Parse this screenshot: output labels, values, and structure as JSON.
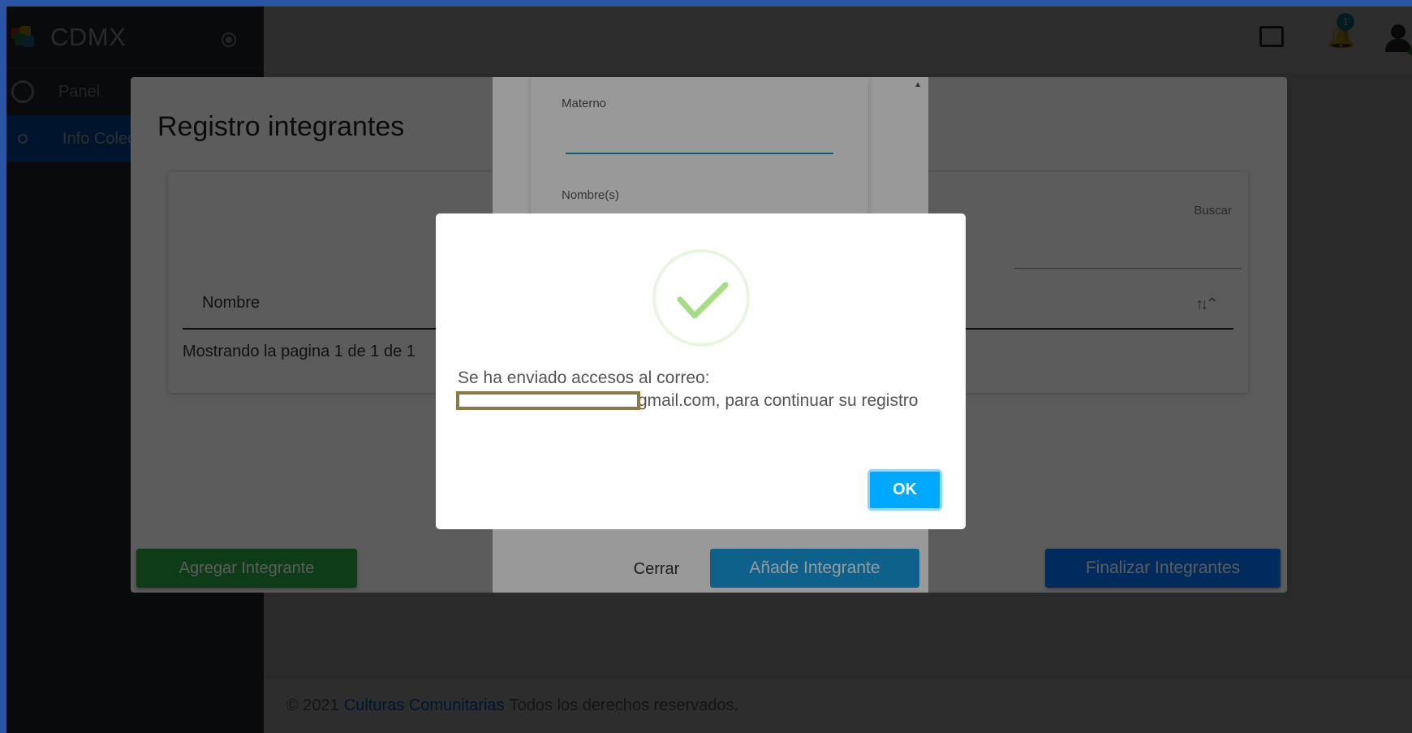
{
  "sidebar": {
    "brand": "CDMX",
    "items": [
      {
        "label": "Panel"
      },
      {
        "label": "Info Colectivo"
      }
    ]
  },
  "topbar": {
    "notification_count": "1"
  },
  "footer": {
    "copyright": "© 2021",
    "link": "Culturas Comunitarias",
    "rights": "Todos los derechos reservados."
  },
  "registro_modal": {
    "title": "Registro integrantes",
    "search_label": "Buscar",
    "column_header": "Nombre",
    "pagination_text": "Mostrando la pagina 1 de 1 de 1",
    "add_button": "Agregar Integrante",
    "finish_button": "Finalizar Integrantes"
  },
  "add_modal": {
    "materno_label": "Materno",
    "materno_value": "",
    "nombre_label": "Nombre(s)",
    "close_button": "Cerrar",
    "add_button": "Añade Integrante"
  },
  "alert": {
    "message": "Se ha enviado accesos al correo: xxxxxxxxxxxxxxxxxx2@gmail.com, para continuar su registro",
    "ok_button": "OK",
    "icon": "success-check-icon",
    "check_color": "#a5dc86"
  }
}
